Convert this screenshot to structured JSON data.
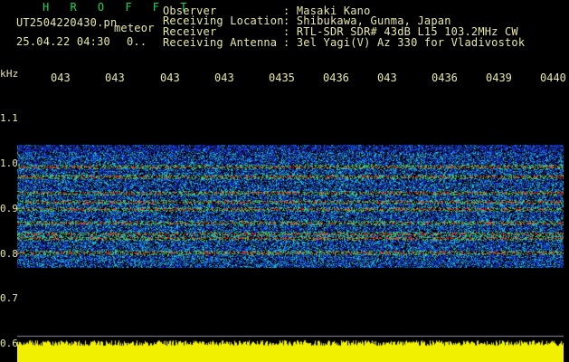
{
  "header": {
    "brand": "H R O F F T",
    "filename": "UT2504220430.pn",
    "meteor_label": "meteor",
    "datetime": "25.04.22 04:30",
    "dot_text": "0..",
    "observer_label": "Observer",
    "observer_value": ": Masaki Kano",
    "location_label": "Receiving Location",
    "location_value": ": Shibukawa, Gunma, Japan",
    "receiver_label": "Receiver",
    "receiver_value": ": RTL-SDR SDR# 43dB L15 103.2MHz CW",
    "antenna_label": "Receiving Antenna",
    "antenna_value": ": 3el Yagi(V) Az 330 for Vladivostok"
  },
  "axis": {
    "unit": "kHz",
    "x_ticks": [
      "043̱",
      "043̱",
      "043̱",
      "043̱",
      "043̵",
      "043̶",
      "043̱",
      "043̶",
      "043̹",
      "0440"
    ],
    "y_ticks": [
      "1.1",
      "1.0",
      "0.9",
      "0.8",
      "0.7",
      "0.6"
    ]
  },
  "colors": {
    "background": "#000000",
    "text": "#e8e8a8",
    "brand": "#19d35a",
    "noise": "#1428a0",
    "signal_mid": "#22c0c0",
    "signal_high": "#e02020",
    "amplitude": "#f0f000"
  }
}
